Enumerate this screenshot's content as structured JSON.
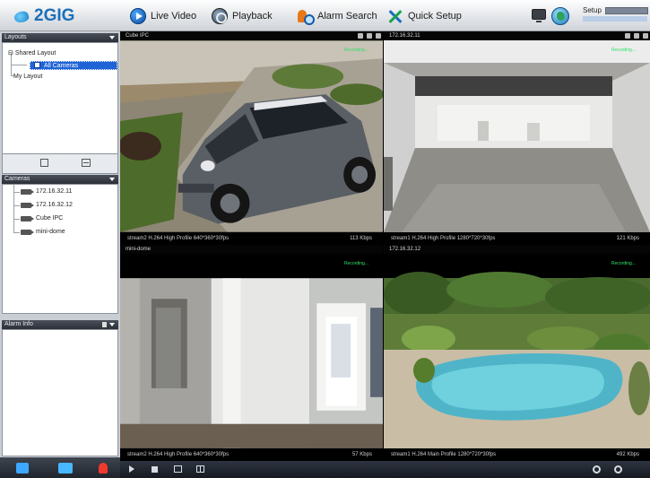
{
  "app": {
    "logo_text": "2GIG"
  },
  "toolbar": {
    "live_video": "Live Video",
    "playback": "Playback",
    "alarm_search": "Alarm Search",
    "quick_setup": "Quick Setup",
    "setup_label": "Setup"
  },
  "layouts": {
    "header": "Layouts",
    "shared": "Shared Layout",
    "all_cameras": "All Cameras",
    "my_layout": "My Layout"
  },
  "cameras": {
    "header": "Cameras",
    "items": [
      "172.16.32.11",
      "172.16.32.12",
      "Cube IPC",
      "mini-dome"
    ]
  },
  "alarms": {
    "header": "Alarm Info"
  },
  "tiles": [
    {
      "title": "Cube IPC",
      "rec": "Recording...",
      "status": "stream2 H.264 High Profile 640*360*30fps",
      "rate": "113 Kbps"
    },
    {
      "title": "172.16.32.11",
      "rec": "Recording...",
      "status": "stream1 H.264 High Profile 1280*720*30fps",
      "rate": "121 Kbps"
    },
    {
      "title": "mini-dome",
      "rec": "Recording...",
      "status": "stream2 H.264 High Profile 640*360*30fps",
      "rate": "57 Kbps"
    },
    {
      "title": "172.16.32.12",
      "rec": "Recording...",
      "status": "stream1 H.264 Main Profile 1280*720*30fps",
      "rate": "492 Kbps"
    }
  ],
  "colors": {
    "accent": "#1f63d6",
    "recording": "#2fe06a",
    "brand": "#1c6fb8"
  }
}
